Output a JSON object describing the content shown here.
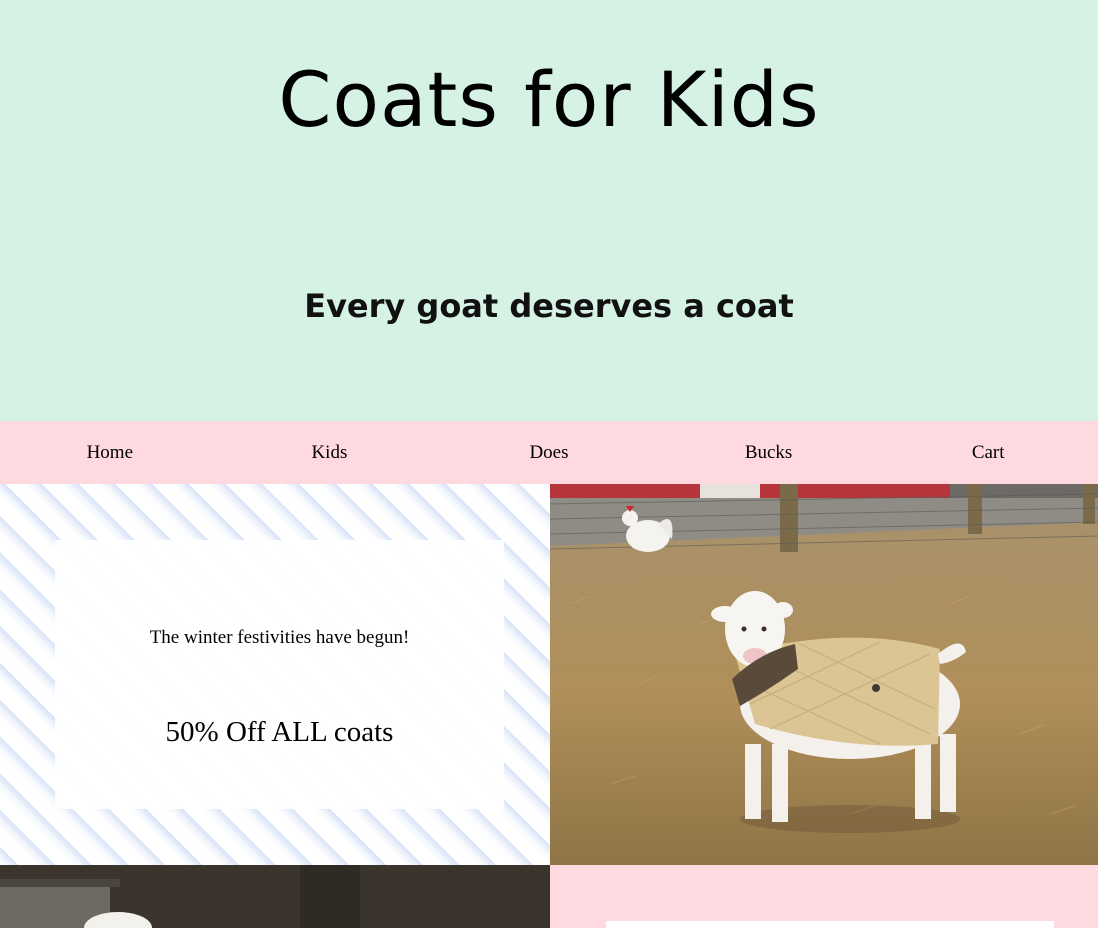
{
  "hero": {
    "title": "Coats for Kids",
    "tagline": "Every goat deserves a coat",
    "background_color": "#d5f2e5"
  },
  "nav": {
    "background_color": "#ffd9e0",
    "items": [
      {
        "label": "Home"
      },
      {
        "label": "Kids"
      },
      {
        "label": "Does"
      },
      {
        "label": "Bucks"
      },
      {
        "label": "Cart"
      }
    ]
  },
  "promo": {
    "line1": "The winter festivities have begun!",
    "line2": "50% Off ALL coats"
  },
  "photo": {
    "subject": "goat-kid-in-tan-quilted-coat",
    "icon": "goat-photo"
  }
}
